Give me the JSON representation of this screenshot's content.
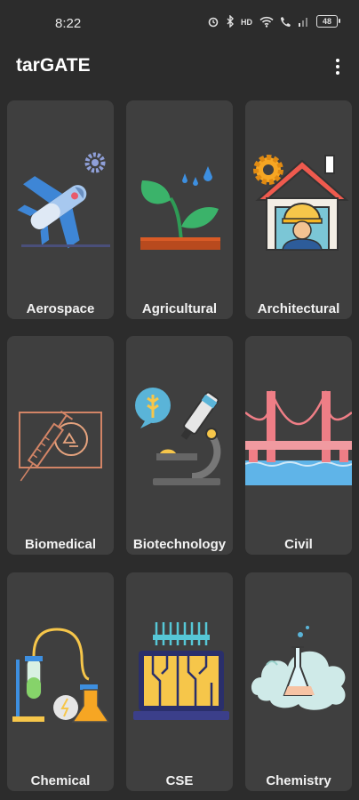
{
  "status_bar": {
    "time": "8:22",
    "battery": "48"
  },
  "app_bar": {
    "title": "tarGATE"
  },
  "cards": [
    {
      "label": "Aerospace",
      "icon": "airplane-icon"
    },
    {
      "label": "Agricultural",
      "icon": "plant-icon"
    },
    {
      "label": "Architectural",
      "icon": "engineer-house-icon"
    },
    {
      "label": "Biomedical",
      "icon": "syringe-icon"
    },
    {
      "label": "Biotechnology",
      "icon": "microscope-icon"
    },
    {
      "label": "Civil",
      "icon": "bridge-icon"
    },
    {
      "label": "Chemical",
      "icon": "lab-tubes-icon"
    },
    {
      "label": "CSE",
      "icon": "laptop-circuit-icon"
    },
    {
      "label": "Chemistry",
      "icon": "flask-cloud-icon"
    }
  ]
}
